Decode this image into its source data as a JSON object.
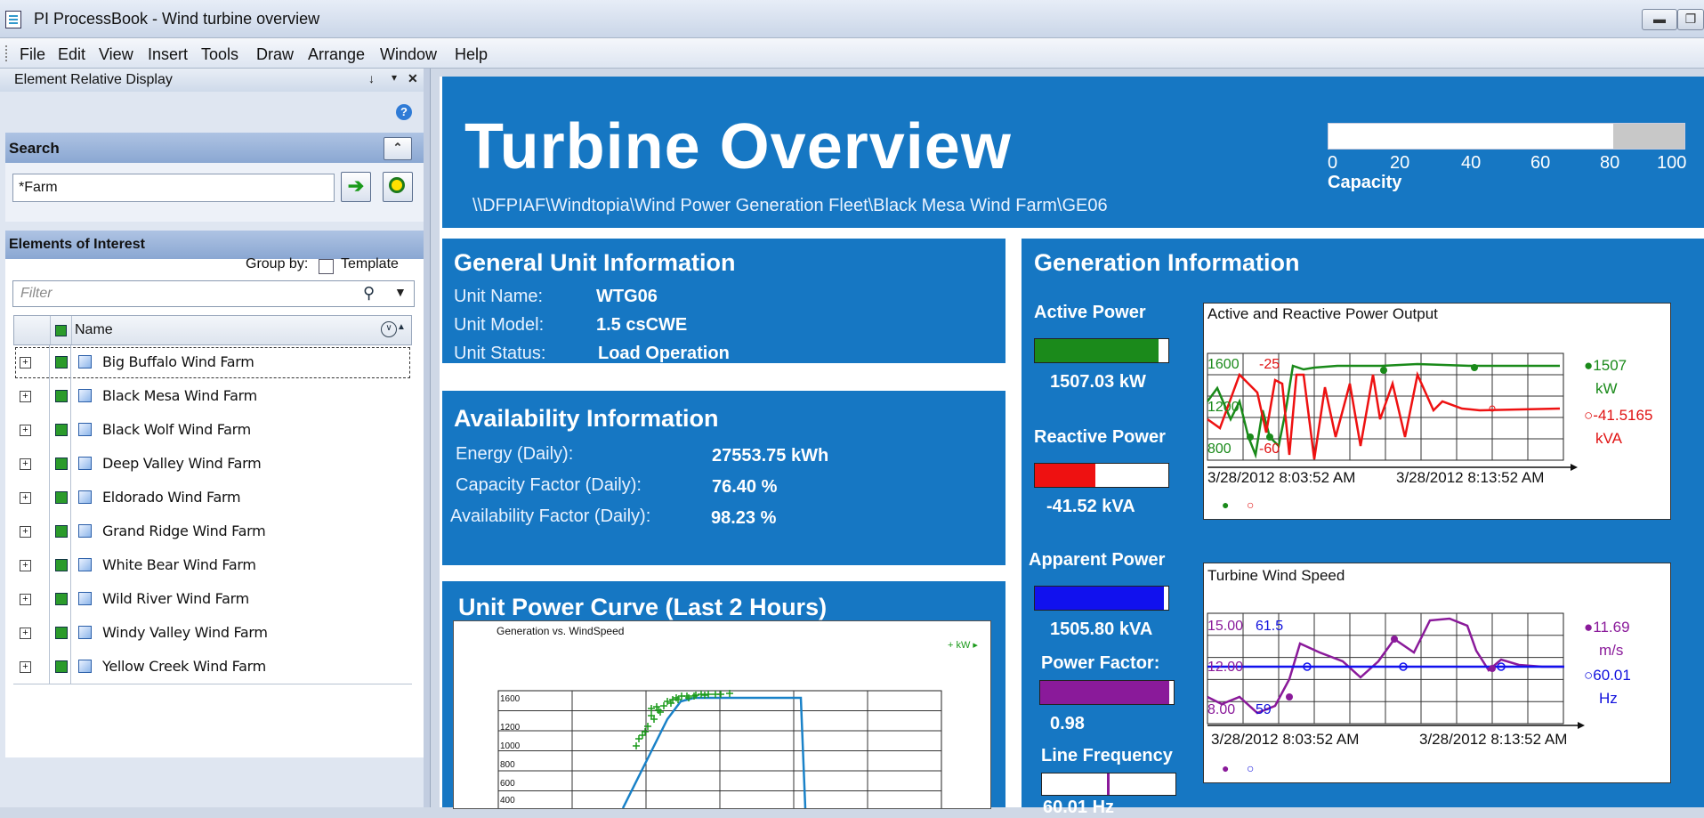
{
  "window": {
    "title": "PI ProcessBook - Wind turbine overview"
  },
  "menu": [
    "File",
    "Edit",
    "View",
    "Insert",
    "Tools",
    "Draw",
    "Arrange",
    "Window",
    "Help"
  ],
  "left_panel": {
    "title": "Element Relative Display",
    "pin": "↑",
    "close": "✕",
    "search": {
      "header": "Search",
      "value": "*Farm"
    },
    "eoi": {
      "header": "Elements of Interest",
      "group_by": "Group by:",
      "template_label": "Template",
      "filter_placeholder": "Filter",
      "col_name": "Name",
      "items": [
        "Big Buffalo Wind Farm",
        "Black Mesa Wind Farm",
        "Black Wolf Wind Farm",
        "Deep Valley Wind Farm",
        "Eldorado Wind Farm",
        "Grand Ridge Wind Farm",
        "White Bear Wind Farm",
        "Wild River Wind Farm",
        "Windy Valley Wind Farm",
        "Yellow Creek Wind Farm"
      ]
    }
  },
  "display": {
    "title": "Turbine Overview",
    "path": "\\\\DFPIAF\\Windtopia\\Wind Power Generation Fleet\\Black Mesa Wind Farm\\GE06",
    "capacity": {
      "label": "Capacity",
      "ticks": [
        "0",
        "20",
        "40",
        "60",
        "80",
        "100"
      ],
      "value": 76.4
    },
    "general": {
      "title": "General Unit Information",
      "rows": [
        {
          "label": "Unit Name:",
          "value": "WTG06"
        },
        {
          "label": "Unit Model:",
          "value": "1.5 csCWE"
        },
        {
          "label": "Unit Status:",
          "value": "Load Operation"
        }
      ]
    },
    "availability": {
      "title": "Availability Information",
      "rows": [
        {
          "label": "Energy (Daily):",
          "value": "27553.75 kWh"
        },
        {
          "label": "Capacity Factor (Daily):",
          "value": "76.40 %"
        },
        {
          "label": "Availability Factor (Daily):",
          "value": "98.23 %"
        }
      ]
    },
    "power_curve": {
      "title": "Unit Power Curve (Last 2 Hours)",
      "chart_title": "Generation vs. WindSpeed",
      "legend": "kW",
      "y_ticks": [
        "1600",
        "1200",
        "1000",
        "800",
        "600",
        "400"
      ]
    },
    "generation": {
      "title": "Generation Information",
      "active": {
        "label": "Active Power",
        "value": "1507.03 kW",
        "fill": 0.94,
        "color": "#1b8a1b"
      },
      "reactive": {
        "label": "Reactive Power",
        "value": "-41.52 kVA",
        "fill": 0.46,
        "color": "#ee1111"
      },
      "apparent": {
        "label": "Apparent Power",
        "value": "1505.80 kVA",
        "fill": 0.98,
        "color": "#1111ee"
      },
      "pf": {
        "label": "Power Factor:",
        "value": "0.98",
        "fill": 0.98,
        "color": "#8a1a9a"
      },
      "freq": {
        "label": "Line Frequency",
        "value": "60.01 Hz",
        "fill": 0.5,
        "color": "#8a1a9a"
      }
    },
    "trend1": {
      "title": "Active and Reactive Power Output",
      "t_start": "3/28/2012 8:03:52 AM",
      "t_end": "3/28/2012 8:13:52 AM",
      "y_top_a": "1600",
      "y_bot_a": "800",
      "y_mid_a": "1200",
      "y_top_b": "-25",
      "y_bot_b": "-60",
      "val_a": "1507",
      "unit_a": "kW",
      "val_b": "-41.5165",
      "unit_b": "kVA"
    },
    "trend2": {
      "title": "Turbine Wind Speed",
      "t_start": "3/28/2012 8:03:52 AM",
      "t_end": "3/28/2012 8:13:52 AM",
      "y_top_a": "15.00",
      "y_mid_a": "12.00",
      "y_bot_a": "8.00",
      "y_top_b": "61.5",
      "y_bot_b": "59",
      "val_a": "11.69",
      "unit_a": "m/s",
      "val_b": "60.01",
      "unit_b": "Hz"
    }
  }
}
